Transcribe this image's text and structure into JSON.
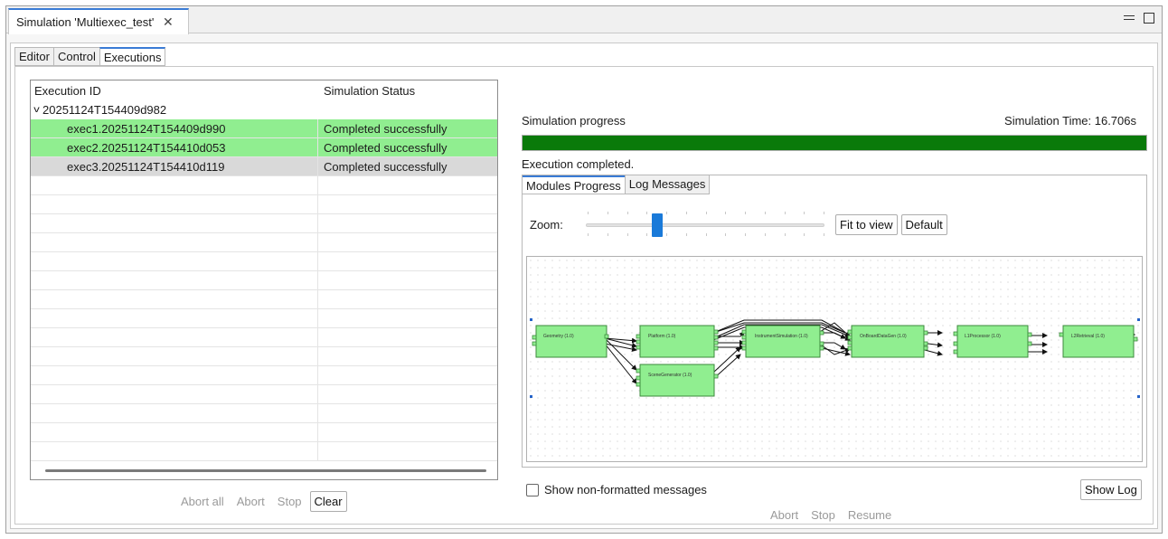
{
  "editor_tab": {
    "title": "Simulation 'Multiexec_test'"
  },
  "subtabs": [
    "Editor",
    "Control",
    "Executions"
  ],
  "exec_table": {
    "columns": [
      "Execution ID",
      "Simulation Status"
    ],
    "group": "20251124T154409d982",
    "rows": [
      {
        "id": "exec1.20251124T154409d990",
        "status": "Completed successfully"
      },
      {
        "id": "exec2.20251124T154410d053",
        "status": "Completed successfully"
      },
      {
        "id": "exec3.20251124T154410d119",
        "status": "Completed successfully"
      }
    ]
  },
  "left_buttons": {
    "abort_all": "Abort all",
    "abort": "Abort",
    "stop": "Stop",
    "clear": "Clear"
  },
  "progress": {
    "label": "Simulation progress",
    "time_label": "Simulation Time: 16.706s",
    "percent": 100,
    "status": "Execution completed."
  },
  "inner_tabs": [
    "Modules Progress",
    "Log Messages"
  ],
  "zoom": {
    "label": "Zoom:",
    "level_fraction": 0.3,
    "fit": "Fit to view",
    "default": "Default"
  },
  "diagram": {
    "modules": [
      {
        "name": "Geometry (1.0)"
      },
      {
        "name": "Platform (1.0)"
      },
      {
        "name": "SceneGenerator (1.0)"
      },
      {
        "name": "InstrumentSimulation (1.0)"
      },
      {
        "name": "OnBoardDataGen (1.0)"
      },
      {
        "name": "L1Processor (1.0)"
      },
      {
        "name": "L2Retrieval (1.0)"
      }
    ]
  },
  "show_non_formatted": "Show non-formatted messages",
  "show_log": "Show Log",
  "right_buttons": {
    "abort": "Abort",
    "stop": "Stop",
    "resume": "Resume"
  },
  "colors": {
    "complete": "#90ee90",
    "progress": "#0a7a0a",
    "accent": "#3a7bd5",
    "module": "#90ee90"
  }
}
